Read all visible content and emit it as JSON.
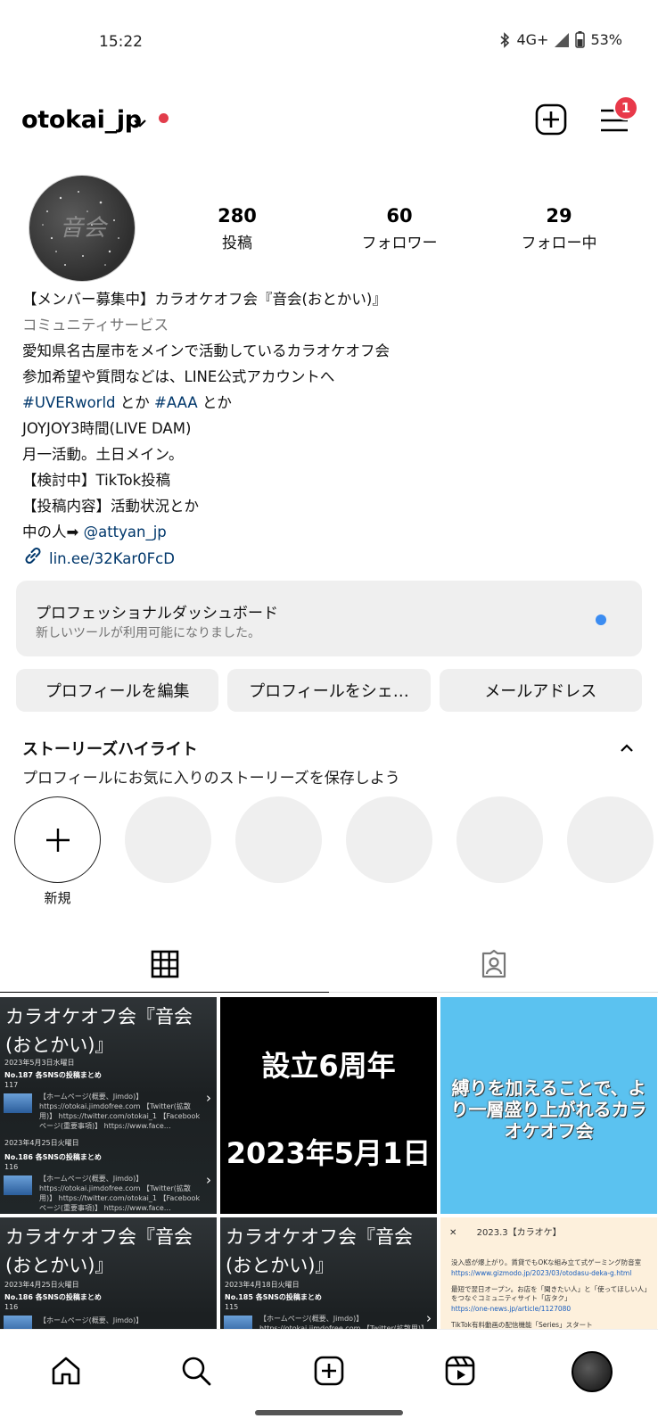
{
  "status_bar": {
    "time": "15:22",
    "network": "4G+",
    "battery": "53%"
  },
  "header": {
    "username": "otokai_jp",
    "notification_count": "1"
  },
  "profile": {
    "avatar_text": "音会",
    "stats": [
      {
        "num": "280",
        "label": "投稿"
      },
      {
        "num": "60",
        "label": "フォロワー"
      },
      {
        "num": "29",
        "label": "フォロー中"
      }
    ]
  },
  "bio": {
    "name": "【メンバー募集中】カラオケオフ会『音会(おとかい)』",
    "category": "コミュニティサービス",
    "lines": [
      "愛知県名古屋市をメインで活動しているカラオケオフ会",
      "参加希望や質問などは、LINE公式アカウントへ"
    ],
    "hashtag1": "#UVERworld",
    "toka1": " とか ",
    "hashtag2": "#AAA",
    "toka2": " とか",
    "lines2": [
      "JOYJOY3時間(LIVE DAM)",
      "月一活動。土日メイン。",
      "【検討中】TikTok投稿",
      "【投稿内容】活動状況とか"
    ],
    "inner_prefix": "中の人➡ ",
    "inner_handle": "@attyan_jp",
    "link": "lin.ee/32Kar0FcD"
  },
  "dashboard": {
    "title": "プロフェッショナルダッシュボード",
    "subtitle": "新しいツールが利用可能になりました。"
  },
  "buttons": {
    "edit": "プロフィールを編集",
    "share": "プロフィールをシェ…",
    "email": "メールアドレス"
  },
  "highlights": {
    "title": "ストーリーズハイライト",
    "subtitle": "プロフィールにお気に入りのストーリーズを保存しよう",
    "new_label": "新規"
  },
  "posts": {
    "p1": {
      "caption": "カラオケオフ会『音会(おとかい)』",
      "date1": "2023年5月3日水曜日",
      "title1": "No.187 各SNSの投稿まとめ",
      "count1": "117",
      "body1": "【ホームページ(概要、Jimdo)】 https://otokai.jimdofree.com 【Twitter(拡散用)】 https://twitter.com/otokai_1 【Facebookページ(重要事項)】 https://www.face…",
      "date2": "2023年4月25日火曜日",
      "title2": "No.186 各SNSの投稿まとめ",
      "count2": "116",
      "body2": "【ホームページ(概要、Jimdo)】 https://otokai.jimdofree.com 【Twitter(拡散用)】 https://twitter.com/otokai_1 【Facebookページ(重要事項)】 https://www.face…"
    },
    "p2": {
      "line1": "設立6周年",
      "line2": "2023年5月1日"
    },
    "p3": {
      "text": "縛りを加えることで、より一層盛り上がれるカラオケオフ会"
    },
    "p4": {
      "caption": "カラオケオフ会『音会(おとかい)』",
      "date": "2023年4月25日火曜日",
      "title": "No.186 各SNSの投稿まとめ",
      "count": "116",
      "body": "【ホームページ(概要、Jimdo)】"
    },
    "p5": {
      "caption": "カラオケオフ会『音会(おとかい)』",
      "date": "2023年4月18日火曜日",
      "title": "No.185 各SNSの投稿まとめ",
      "count": "115",
      "body": "【ホームページ(概要、Jimdo)】 https://otokai.jimdofree.com 【Twitter(拡散用)】"
    },
    "p6": {
      "header": "2023.3【カラオケ】",
      "item1": "没入感が爆上がり。賃貸でもOKな組み立て式ゲーミング防音室",
      "link1": "https://www.gizmodo.jp/2023/03/otodasu-deka-g.html",
      "item2": "最短で翌日オープン。お店を「聞きたい人」と「使ってほしい人」をつなぐコミュニティサイト「店タク」",
      "link2": "https://one-news.jp/article/1127080",
      "item3": "TikTok有料動画の配信機能「Series」スタート"
    }
  }
}
